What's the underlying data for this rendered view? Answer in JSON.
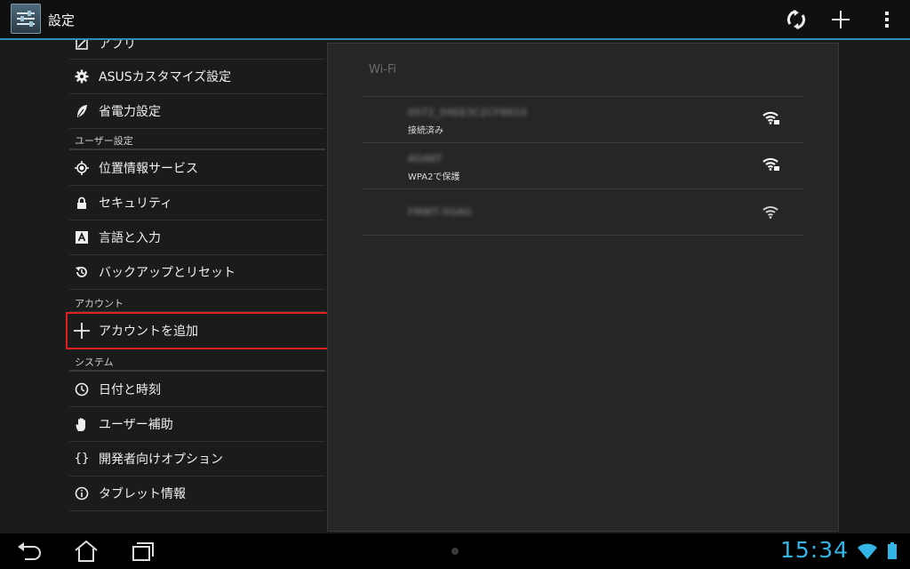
{
  "action_bar": {
    "title": "設定",
    "icons": [
      "settings-app-icon",
      "sync-icon",
      "add-icon",
      "overflow-menu-icon"
    ]
  },
  "sidebar": {
    "top_partial_item": "アプリ",
    "items_device": [
      {
        "label": "ASUSカスタマイズ設定",
        "icon": "gear-icon"
      },
      {
        "label": "省電力設定",
        "icon": "leaf-icon"
      }
    ],
    "section_user": "ユーザー設定",
    "items_user": [
      {
        "label": "位置情報サービス",
        "icon": "location-icon"
      },
      {
        "label": "セキュリティ",
        "icon": "lock-icon"
      },
      {
        "label": "言語と入力",
        "icon": "keyboard-icon"
      },
      {
        "label": "バックアップとリセット",
        "icon": "restore-icon"
      }
    ],
    "section_account": "アカウント",
    "add_account": {
      "label": "アカウントを追加",
      "icon": "plus-icon"
    },
    "section_system": "システム",
    "items_system": [
      {
        "label": "日付と時刻",
        "icon": "clock-icon"
      },
      {
        "label": "ユーザー補助",
        "icon": "hand-icon"
      },
      {
        "label": "開発者向けオプション",
        "icon": "braces-icon"
      },
      {
        "label": "タブレット情報",
        "icon": "info-icon"
      }
    ]
  },
  "wifi": {
    "title": "Wi-Fi",
    "networks": [
      {
        "ssid": "0072_04EE3C2CF6610",
        "status": "接続済み",
        "secured": true
      },
      {
        "ssid": "AGAKT",
        "status": "WPA2で保護",
        "secured": true
      },
      {
        "ssid": "FMWT-5GAG",
        "status": "",
        "secured": false
      }
    ]
  },
  "status_bar": {
    "time": "15:34",
    "accent_color": "#33b5e5"
  },
  "colors": {
    "highlight": "#e02020",
    "accent": "#33b5e5"
  }
}
